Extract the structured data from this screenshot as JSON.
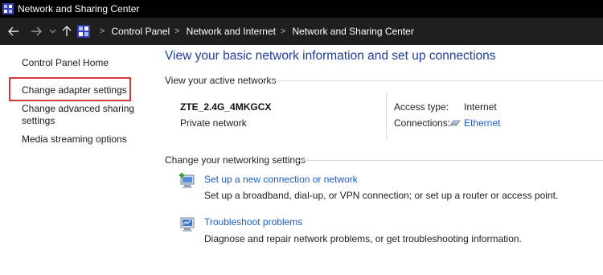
{
  "window": {
    "title": "Network and Sharing Center"
  },
  "addressbar": {
    "crumbs": [
      "Control Panel",
      "Network and Internet",
      "Network and Sharing Center"
    ],
    "sep": ">"
  },
  "sidebar": {
    "items": [
      {
        "label": "Control Panel Home"
      },
      {
        "label": "Change adapter settings"
      },
      {
        "label": "Change advanced sharing"
      },
      {
        "label": "settings"
      },
      {
        "label": "Media streaming options"
      }
    ]
  },
  "main": {
    "headline": "View your basic network information and set up connections",
    "active_label": "View your active networks",
    "network": {
      "name": "ZTE_2.4G_4MKGCX",
      "type": "Private network",
      "access_type_label": "Access type:",
      "access_type_value": "Internet",
      "connections_label": "Connections:",
      "connections_value": "Ethernet"
    },
    "change_label": "Change your networking settings",
    "tasks": [
      {
        "title": "Set up a new connection or network",
        "desc": "Set up a broadband, dial-up, or VPN connection; or set up a router or access point."
      },
      {
        "title": "Troubleshoot problems",
        "desc": "Diagnose and repair network problems, or get troubleshooting information."
      }
    ]
  },
  "colors": {
    "link": "#1e5fbf",
    "headline": "#1e3f9c",
    "highlight": "#d23a3a",
    "titlebar": "#000000",
    "addressbar": "#1f1f1f"
  }
}
